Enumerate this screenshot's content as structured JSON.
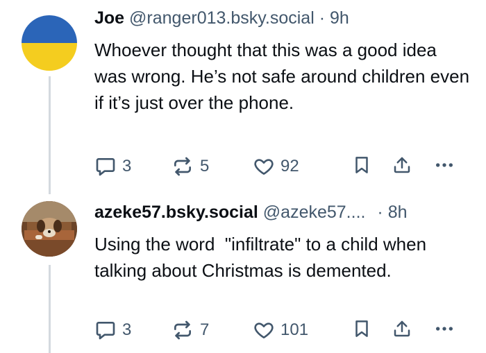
{
  "posts": [
    {
      "display_name": "Joe",
      "handle": "@ranger013.bsky.social",
      "separator": "·",
      "time": "9h",
      "text": "Whoever thought that this was a good idea was wrong. He’s not safe around children even if it’s just over the phone.",
      "replies": "3",
      "reposts": "5",
      "likes": "92",
      "avatar_colors": {
        "top": "#2b65b8",
        "bottom": "#f4cd1f"
      }
    },
    {
      "display_name": "azeke57.bsky.social",
      "handle": "@azeke57....",
      "separator": "·",
      "time": "8h",
      "text": "Using the word  \"infiltrate\" to a child when talking about Christmas is demented.",
      "replies": "3",
      "reposts": "7",
      "likes": "101"
    }
  ],
  "icons": [
    "reply-icon",
    "repost-icon",
    "like-icon",
    "bookmark-icon",
    "share-icon",
    "more-icon"
  ],
  "colors": {
    "text": "#0b0f14",
    "muted": "#42576c",
    "thread_line": "#d4d9df"
  }
}
